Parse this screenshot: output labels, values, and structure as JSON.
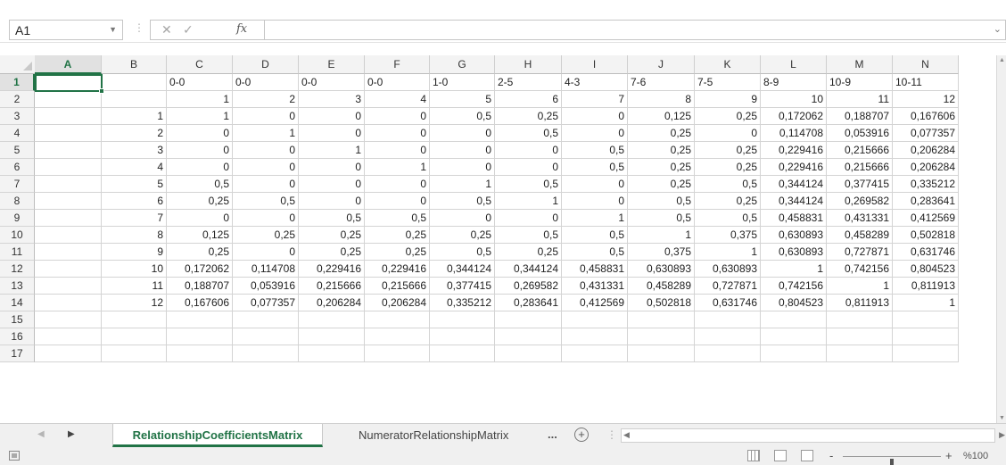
{
  "formula_bar": {
    "name_box": "A1",
    "fx_label": "fx",
    "formula": ""
  },
  "columns": [
    "A",
    "B",
    "C",
    "D",
    "E",
    "F",
    "G",
    "H",
    "I",
    "J",
    "K",
    "L",
    "M",
    "N"
  ],
  "selected_column": "A",
  "selected_row": "1",
  "rows": [
    {
      "n": "1",
      "cells": [
        "",
        "",
        "0-0",
        "0-0",
        "0-0",
        "0-0",
        "1-0",
        "2-5",
        "4-3",
        "7-6",
        "7-5",
        "8-9",
        "10-9",
        "10-11"
      ]
    },
    {
      "n": "2",
      "cells": [
        "",
        "",
        "1",
        "2",
        "3",
        "4",
        "5",
        "6",
        "7",
        "8",
        "9",
        "10",
        "11",
        "12"
      ]
    },
    {
      "n": "3",
      "cells": [
        "",
        "1",
        "1",
        "0",
        "0",
        "0",
        "0,5",
        "0,25",
        "0",
        "0,125",
        "0,25",
        "0,172062",
        "0,188707",
        "0,167606"
      ]
    },
    {
      "n": "4",
      "cells": [
        "",
        "2",
        "0",
        "1",
        "0",
        "0",
        "0",
        "0,5",
        "0",
        "0,25",
        "0",
        "0,114708",
        "0,053916",
        "0,077357"
      ]
    },
    {
      "n": "5",
      "cells": [
        "",
        "3",
        "0",
        "0",
        "1",
        "0",
        "0",
        "0",
        "0,5",
        "0,25",
        "0,25",
        "0,229416",
        "0,215666",
        "0,206284"
      ]
    },
    {
      "n": "6",
      "cells": [
        "",
        "4",
        "0",
        "0",
        "0",
        "1",
        "0",
        "0",
        "0,5",
        "0,25",
        "0,25",
        "0,229416",
        "0,215666",
        "0,206284"
      ]
    },
    {
      "n": "7",
      "cells": [
        "",
        "5",
        "0,5",
        "0",
        "0",
        "0",
        "1",
        "0,5",
        "0",
        "0,25",
        "0,5",
        "0,344124",
        "0,377415",
        "0,335212"
      ]
    },
    {
      "n": "8",
      "cells": [
        "",
        "6",
        "0,25",
        "0,5",
        "0",
        "0",
        "0,5",
        "1",
        "0",
        "0,5",
        "0,25",
        "0,344124",
        "0,269582",
        "0,283641"
      ]
    },
    {
      "n": "9",
      "cells": [
        "",
        "7",
        "0",
        "0",
        "0,5",
        "0,5",
        "0",
        "0",
        "1",
        "0,5",
        "0,5",
        "0,458831",
        "0,431331",
        "0,412569"
      ]
    },
    {
      "n": "10",
      "cells": [
        "",
        "8",
        "0,125",
        "0,25",
        "0,25",
        "0,25",
        "0,25",
        "0,5",
        "0,5",
        "1",
        "0,375",
        "0,630893",
        "0,458289",
        "0,502818"
      ]
    },
    {
      "n": "11",
      "cells": [
        "",
        "9",
        "0,25",
        "0",
        "0,25",
        "0,25",
        "0,5",
        "0,25",
        "0,5",
        "0,375",
        "1",
        "0,630893",
        "0,727871",
        "0,631746"
      ]
    },
    {
      "n": "12",
      "cells": [
        "",
        "10",
        "0,172062",
        "0,114708",
        "0,229416",
        "0,229416",
        "0,344124",
        "0,344124",
        "0,458831",
        "0,630893",
        "0,630893",
        "1",
        "0,742156",
        "0,804523"
      ]
    },
    {
      "n": "13",
      "cells": [
        "",
        "11",
        "0,188707",
        "0,053916",
        "0,215666",
        "0,215666",
        "0,377415",
        "0,269582",
        "0,431331",
        "0,458289",
        "0,727871",
        "0,742156",
        "1",
        "0,811913"
      ]
    },
    {
      "n": "14",
      "cells": [
        "",
        "12",
        "0,167606",
        "0,077357",
        "0,206284",
        "0,206284",
        "0,335212",
        "0,283641",
        "0,412569",
        "0,502818",
        "0,631746",
        "0,804523",
        "0,811913",
        "1"
      ]
    },
    {
      "n": "15",
      "cells": [
        "",
        "",
        "",
        "",
        "",
        "",
        "",
        "",
        "",
        "",
        "",
        "",
        "",
        ""
      ]
    },
    {
      "n": "16",
      "cells": [
        "",
        "",
        "",
        "",
        "",
        "",
        "",
        "",
        "",
        "",
        "",
        "",
        "",
        ""
      ]
    },
    {
      "n": "17",
      "cells": [
        "",
        "",
        "",
        "",
        "",
        "",
        "",
        "",
        "",
        "",
        "",
        "",
        "",
        ""
      ]
    }
  ],
  "sheet_tabs": {
    "active": "RelationshipCoefficientsMatrix",
    "inactive": "NumeratorRelationshipMatrix",
    "more": "...",
    "add": "+"
  },
  "status_bar": {
    "zoom": "%100",
    "zoom_minus": "-",
    "zoom_plus": "+",
    "zoom_fraction": 0.5
  },
  "colors": {
    "accent": "#217346",
    "gridline": "#d4d4d4",
    "header_bg": "#f3f3f3"
  }
}
